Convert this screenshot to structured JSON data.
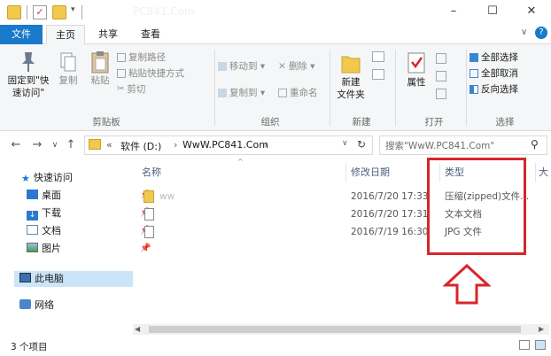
{
  "window": {
    "title": "PC841.Com",
    "minimize_glyph": "–",
    "maximize_glyph": "☐",
    "close_glyph": "✕"
  },
  "tabs": {
    "file": "文件",
    "home": "主页",
    "share": "共享",
    "view": "查看"
  },
  "ribbon": {
    "clipboard": {
      "pin_label_1": "固定到\"快",
      "pin_label_2": "速访问\"",
      "copy": "复制",
      "paste": "粘贴",
      "copy_path": "复制路径",
      "paste_shortcut": "粘贴快捷方式",
      "cut": "剪切",
      "group_label": "剪贴板"
    },
    "organize": {
      "move_to": "移动到",
      "copy_to": "复制到",
      "delete": "删除",
      "rename": "重命名",
      "group_label": "组织"
    },
    "new": {
      "new_folder_1": "新建",
      "new_folder_2": "文件夹",
      "group_label": "新建"
    },
    "open": {
      "properties": "属性",
      "group_label": "打开"
    },
    "select": {
      "select_all": "全部选择",
      "select_none": "全部取消",
      "invert": "反向选择",
      "group_label": "选择"
    }
  },
  "address": {
    "chevron": "«",
    "crumb_drive": "软件 (D:)",
    "crumb_folder": "WwW.PC841.Com",
    "search_placeholder": "搜索\"WwW.PC841.Com\""
  },
  "nav": {
    "quick_access": "快速访问",
    "items": [
      {
        "label": "桌面",
        "icon": "desktop-icon"
      },
      {
        "label": "下载",
        "icon": "download-icon"
      },
      {
        "label": "文档",
        "icon": "document-icon"
      },
      {
        "label": "图片",
        "icon": "picture-icon"
      }
    ],
    "this_pc": "此电脑",
    "network": "网络"
  },
  "columns": {
    "name": "名称",
    "date_modified": "修改日期",
    "type": "类型",
    "size": "大"
  },
  "files": [
    {
      "name": "ww",
      "date": "2016/7/20 17:33",
      "type": "压缩(zipped)文件...",
      "icon": "zip-folder-icon"
    },
    {
      "name": "",
      "date": "2016/7/20 17:31",
      "type": "文本文档",
      "icon": "text-file-icon"
    },
    {
      "name": "",
      "date": "2016/7/19 16:30",
      "type": "JPG 文件",
      "icon": "image-file-icon"
    }
  ],
  "status": {
    "item_count": "3 个项目"
  },
  "annotation_color": "#d9252b"
}
